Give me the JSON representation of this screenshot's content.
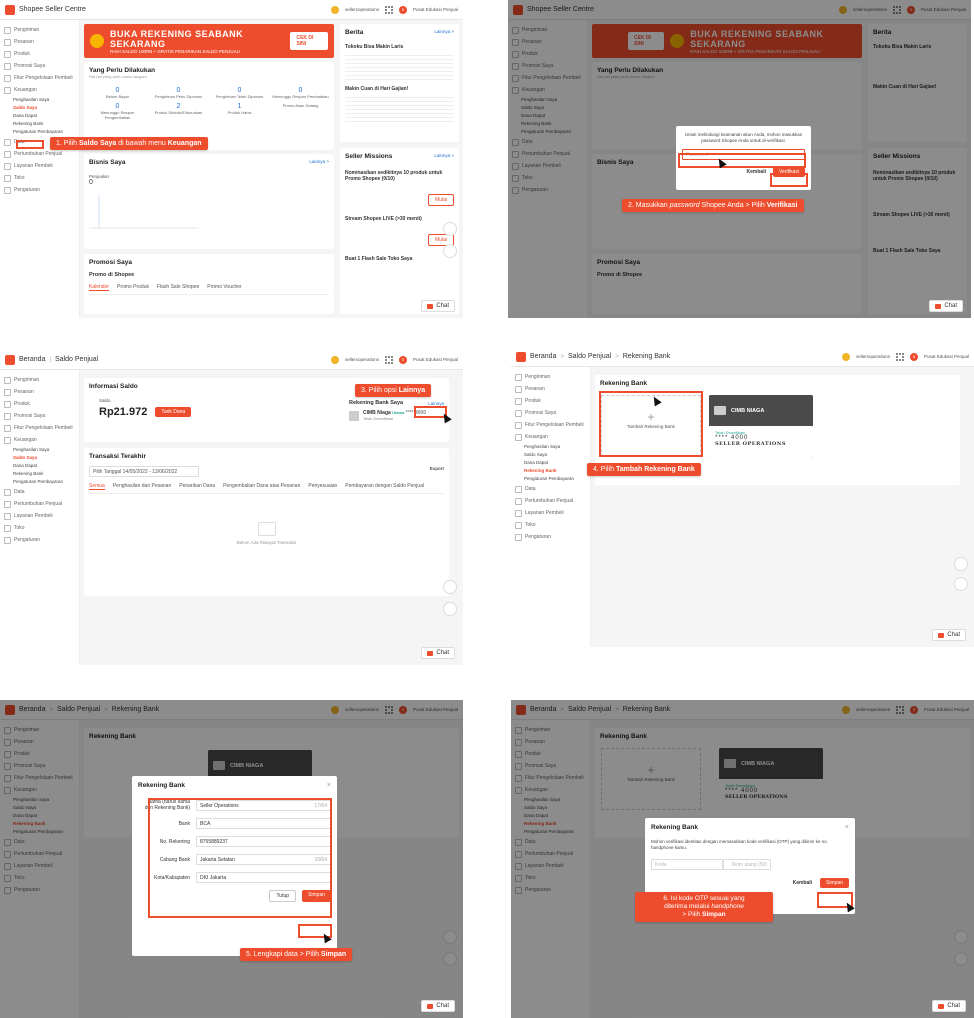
{
  "sidebar": {
    "items": [
      "Pengiriman",
      "Pesanan",
      "Produk",
      "Promosi Saya",
      "Fitur Pengelolaan Pembeli",
      "Keuangan",
      "Data",
      "Pertumbuhan Penjual",
      "Layanan Pembeli",
      "Toko",
      "Pengaturan"
    ],
    "finance_sub": [
      "Penghasilan Saya",
      "Saldo Saya",
      "Dana Dapat",
      "Rekening Bank",
      "Pengaturan Pembayaran"
    ]
  },
  "top": {
    "brand": "Shopee Seller Centre",
    "home": "Beranda",
    "saldo": "Saldo Penjual",
    "rekening": "Rekening Bank",
    "user": "sellersoperations",
    "edukasi": "Pusat Edukasi Penjual",
    "notif_count": "5"
  },
  "chat_label": "Chat",
  "p1": {
    "banner_title": "BUKA REKENING SEABANK SEKARANG",
    "banner_sub": "RAIH SALDO 100RB + GRATIS PENARIKAN SALDO PENJUAL!",
    "banner_cta": "CEK DI SINI",
    "todo_title": "Yang Perlu Dilakukan",
    "todo_sub": "Hal-hal yang perlu kamu tangani",
    "kpis": [
      {
        "n": "0",
        "l": "Belum Bayar"
      },
      {
        "n": "0",
        "l": "Pengiriman Perlu Diproses"
      },
      {
        "n": "0",
        "l": "Pengiriman Telah Diproses"
      },
      {
        "n": "0",
        "l": "Menunggu Respon Pembatalan"
      },
      {
        "n": "0",
        "l": "Menunggu Respon Pengembalian"
      },
      {
        "n": "2",
        "l": "Produk Diblokir/Diturunkan"
      },
      {
        "n": "1",
        "l": "Produk Habis"
      },
      {
        "n": "",
        "l": "Promo Akan Datang"
      }
    ],
    "bisnis_title": "Bisnis Saya",
    "bisnis_link": "Lainnya >",
    "penjualan_label": "Penjualan",
    "penjualan_val": "0",
    "promosi_title": "Promosi Saya",
    "promo_shopee": "Promo di Shopee",
    "promo_tabs": [
      "Kalender",
      "Promo Produk",
      "Flash Sale Shopee",
      "Promo Voucher"
    ],
    "berita_title": "Berita",
    "berita_link": "Lainnya >",
    "berita_items": [
      "Tokoku Bisa Makin Laris",
      "Makin Cuan di Hari Gajian!"
    ],
    "missions_title": "Seller Missions",
    "missions_link": "Lainnya >",
    "missions": [
      "Nominasikan sedikitnya 10 produk untuk Promo Shopee (0/10)",
      "Stream Shopee LIVE (>30 menit)",
      "Buat 1 Flash Sale Toko Saya"
    ],
    "mulai": "Mulai",
    "callout": "1. Pilih Saldo Saya di bawah menu Keuangan",
    "callout_b1": "Saldo Saya",
    "callout_b2": "Keuangan"
  },
  "p2": {
    "modal_text": "Untuk melindungi keamanan akun Anda, mohon masukkan password Shopee Anda untuk di-verifikasi.",
    "password_placeholder": "Password",
    "kembali": "Kembali",
    "verifikasi": "Verifikasi",
    "callout_a": "2. Masukkan ",
    "callout_i": "password",
    "callout_b": " Shopee Anda > Pilih ",
    "callout_c": "Verifikasi"
  },
  "p3": {
    "info_title": "Informasi Saldo",
    "saldo_label": "Saldo",
    "saldo_value": "Rp21.972",
    "tarik": "Tarik Dana",
    "rek_title": "Rekening Bank Saya",
    "lainnya": "Lainnya",
    "bank_name": "CIMB Niaga",
    "bank_tag": "Utama",
    "bank_mask": "**** 4000",
    "bank_status": "Telah Diverifikasi",
    "tx_title": "Transaksi Terakhir",
    "date_filter": "Pilih Tanggal  14/05/2022 - 13/06/2022",
    "export": "Export",
    "tx_tabs": [
      "Semua",
      "Penghasilan dari Pesanan",
      "Penarikan Dana",
      "Pengembalian Dana atas Pesanan",
      "Penyesuaian",
      "Pembayaran dengan Saldo Penjual"
    ],
    "empty": "Belum Ada Riwayat Transaksi",
    "callout_a": "3. Pilih opsi ",
    "callout_b": "Lainnya"
  },
  "p4": {
    "title": "Rekening Bank",
    "add": "Tambah Rekening Bank",
    "bank_name": "CIMB NIAGA",
    "bank_status": "Telah Diverifikasi",
    "bank_mask": "**** 4000",
    "owner": "SELLER OPERATIONS",
    "callout_a": "4. Pilih ",
    "callout_b": "Tambah Rekening Bank"
  },
  "p5": {
    "modal_title": "Rekening Bank",
    "fields": [
      {
        "label": "Nama (harus sama dgn Rekening Bank)",
        "value": "Seller Operations",
        "count": "17/64"
      },
      {
        "label": "Bank",
        "value": "BCA",
        "count": ""
      },
      {
        "label": "No. Rekening",
        "value": "8755889237",
        "count": ""
      },
      {
        "label": "Cabang Bank",
        "value": "Jakarta Selatan",
        "count": "15/64"
      },
      {
        "label": "Kota/Kabupaten",
        "value": "DKI Jakarta",
        "count": ""
      }
    ],
    "tutup": "Tutup",
    "simpan": "Simpan",
    "callout_a": "5. Lengkapi data > Pilih ",
    "callout_b": "Simpan"
  },
  "p6": {
    "modal_title": "Rekening Bank",
    "modal_text": "Mohon verifikasi identitas dengan memasukkan kode verifikasi (OTP) yang dikirim ke no. handphone kamu.",
    "otp_placeholder": "Kode",
    "resend": "Kirim ulang (59)",
    "kembali": "Kembali",
    "simpan": "Simpan",
    "callout_1": "6. Isi kode OTP sesuai yang",
    "callout_2a": "diterima melalui ",
    "callout_2b": "handphone",
    "callout_3a": "> Pilih ",
    "callout_3b": "Simpan"
  }
}
